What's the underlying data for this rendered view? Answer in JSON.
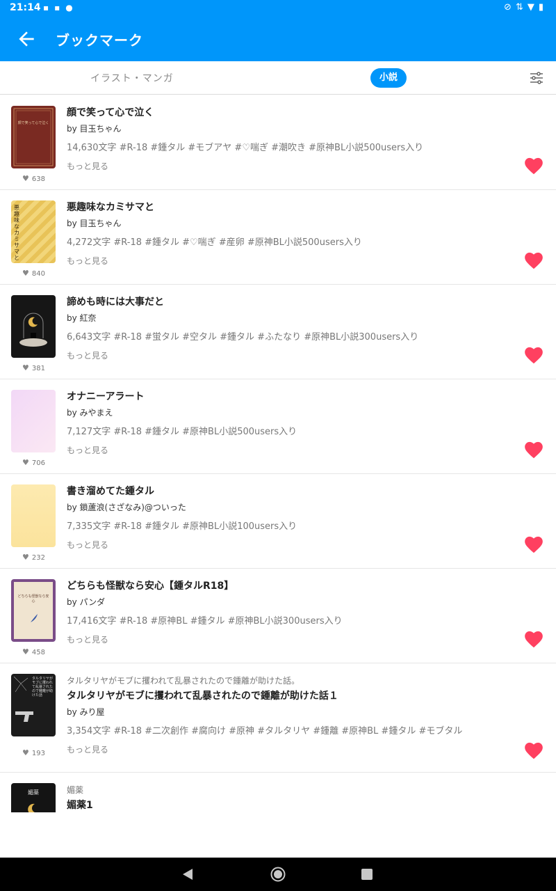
{
  "status_bar": {
    "time": "21:14",
    "left_icons": [
      "notification-icon",
      "notification-icon",
      "chat-icon"
    ],
    "right_icons": [
      "silent-icon",
      "data-icon",
      "wifi-icon",
      "battery-icon"
    ]
  },
  "app_bar": {
    "title": "ブックマーク",
    "back_icon": "arrow-left-icon"
  },
  "tabs": {
    "illust_label": "イラスト・マンガ",
    "novel_label": "小説",
    "active": "小説",
    "filter_icon": "sliders-icon"
  },
  "colors": {
    "accent": "#0096fa",
    "heart": "#ff4060"
  },
  "items": [
    {
      "title": "顔で笑って心で泣く",
      "author": "by 目玉ちゃん",
      "tags": "14,630文字 #R-18 #鍾タル #モブアヤ #♡喘ぎ #潮吹き #原神BL小説500users入り",
      "more": "もっと見る",
      "likes": "638",
      "cover_text": "顔で笑って心で泣く"
    },
    {
      "title": "悪趣味なカミサマと",
      "author": "by 目玉ちゃん",
      "tags": "4,272文字 #R-18 #鍾タル #♡喘ぎ #産卵 #原神BL小説500users入り",
      "more": "もっと見る",
      "likes": "840",
      "cover_text": "悪趣味なカミサマと"
    },
    {
      "title": "諦めも時には大事だと",
      "author": "by 紅奈",
      "tags": "6,643文字 #R-18 #蛍タル #空タル #鍾タル #ふたなり #原神BL小説300users入り",
      "more": "もっと見る",
      "likes": "381"
    },
    {
      "title": "オナニーアラート",
      "author": "by みやまえ",
      "tags": "7,127文字 #R-18 #鍾タル #原神BL小説500users入り",
      "more": "もっと見る",
      "likes": "706"
    },
    {
      "title": "書き溜めてた鍾タル",
      "author": "by 鎖蘆浪(さざなみ)@ついった",
      "tags": "7,335文字 #R-18 #鍾タル #原神BL小説100users入り",
      "more": "もっと見る",
      "likes": "232"
    },
    {
      "title": "どちらも怪獣なら安心【鍾タルR18】",
      "author": "by パンダ",
      "tags": "17,416文字 #R-18 #原神BL #鍾タル #原神BL小説300users入り",
      "more": "もっと見る",
      "likes": "458",
      "cover_text": "どちらも怪獣なら安心"
    },
    {
      "series": "タルタリヤがモブに攫われて乱暴されたので鍾離が助けた話。",
      "title": "タルタリヤがモブに攫われて乱暴されたので鍾離が助けた話１",
      "author": "by みり屋",
      "tags": "3,354文字 #R-18 #二次創作 #腐向け #原神 #タルタリヤ #鍾離 #原神BL #鍾タル #モブタル",
      "more": "もっと見る",
      "likes": "193",
      "cover_text": "タルタリヤがモブに攫われて乱暴されたので鍾離が助けた話"
    },
    {
      "series": "媚薬",
      "title": "媚薬1",
      "cover_text": "媚薬"
    }
  ],
  "nav_bar": {
    "back_icon": "triangle-back-icon",
    "home_icon": "circle-home-icon",
    "recent_icon": "square-recent-icon"
  }
}
